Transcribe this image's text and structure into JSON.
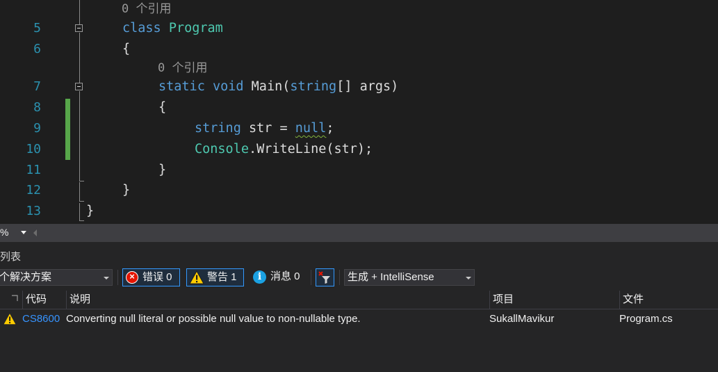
{
  "editor": {
    "codelens_top": "0 个引用",
    "codelens_main": "0 个引用",
    "lines": [
      {
        "num": "5",
        "tokens": [
          {
            "t": "class",
            "c": "kw"
          },
          {
            "t": " "
          },
          {
            "t": "Program",
            "c": "type"
          }
        ]
      },
      {
        "num": "6",
        "tokens": [
          {
            "t": "{"
          }
        ]
      },
      {
        "num": "7",
        "tokens": [
          {
            "t": "static",
            "c": "kw"
          },
          {
            "t": " "
          },
          {
            "t": "void",
            "c": "kw"
          },
          {
            "t": " Main("
          },
          {
            "t": "string",
            "c": "kw"
          },
          {
            "t": "[] args)"
          }
        ]
      },
      {
        "num": "8",
        "tokens": [
          {
            "t": "{"
          }
        ]
      },
      {
        "num": "9",
        "tokens": [
          {
            "t": "string",
            "c": "kw"
          },
          {
            "t": " str = "
          },
          {
            "t": "null",
            "c": "kw",
            "squiggle": true
          },
          {
            "t": ";"
          }
        ]
      },
      {
        "num": "10",
        "tokens": [
          {
            "t": "Console",
            "c": "type"
          },
          {
            "t": ".WriteLine(str);"
          }
        ]
      },
      {
        "num": "11",
        "tokens": [
          {
            "t": "}"
          }
        ]
      },
      {
        "num": "12",
        "tokens": [
          {
            "t": "}"
          }
        ]
      },
      {
        "num": "13",
        "tokens": [
          {
            "t": "}"
          }
        ]
      }
    ]
  },
  "zoom": {
    "label": "%"
  },
  "error_list": {
    "title": "列表",
    "scope": "个解决方案",
    "errors": {
      "label": "错误 0"
    },
    "warnings": {
      "label": "警告 1"
    },
    "messages": {
      "label": "消息 0"
    },
    "build_filter": "生成 + IntelliSense",
    "columns": {
      "code": "代码",
      "description": "说明",
      "project": "项目",
      "file": "文件"
    },
    "rows": [
      {
        "severity": "warning-icon",
        "code": "CS8600",
        "description": "Converting null literal or possible null value to non-nullable type.",
        "project": "SukallMavikur",
        "file": "Program.cs"
      }
    ]
  },
  "colors": {
    "keyword": "#569cd6",
    "type": "#4ec9b0",
    "line_number": "#2b91af",
    "change_mark": "#57a64a",
    "error_code_link": "#3794ff"
  }
}
